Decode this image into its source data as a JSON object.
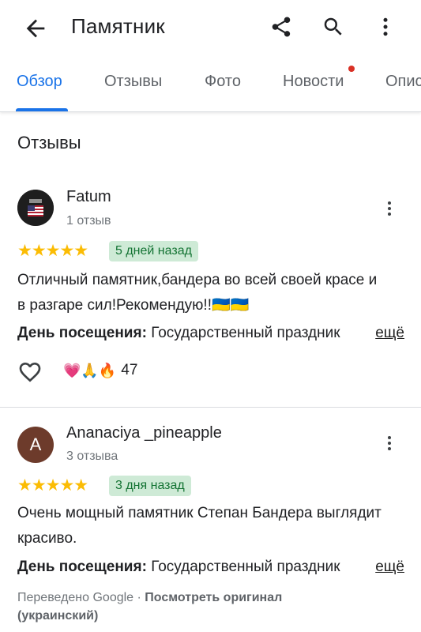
{
  "header": {
    "title": "Памятник"
  },
  "tabs": [
    {
      "label": "Обзор",
      "active": true
    },
    {
      "label": "Отзывы",
      "active": false
    },
    {
      "label": "Фото",
      "active": false
    },
    {
      "label": "Новости",
      "active": false,
      "has_dot": true
    },
    {
      "label": "Описание",
      "active": false
    }
  ],
  "section_title": "Отзывы",
  "reviews": [
    {
      "name": "Fatum",
      "review_count": "1 отзыв",
      "stars": "★★★★★",
      "time": "5 дней назад",
      "text": "Отличный памятник,бандера во всей своей красе и в  разгаре сил!Рекомендую!!🇺🇦🇺🇦",
      "visit_label": "День посещения:",
      "visit_value": "Государственный праздник",
      "more_link": "ещё",
      "reactions": "💗🙏🔥",
      "like_count": "47"
    },
    {
      "name": "Ananaciya _pineapple",
      "avatar_letter": "A",
      "review_count": "3 отзыва",
      "stars": "★★★★★",
      "time": "3 дня назад",
      "text": "Очень мощный памятник Степан Бандера выглядит красиво.",
      "visit_label": "День посещения:",
      "visit_value": "Государственный праздник",
      "more_link": "ещё",
      "translated_prefix": "Переведено Google · ",
      "translated_link": "Посмотреть оригинал",
      "translated_lang": "(украинский)"
    }
  ],
  "colors": {
    "accent": "#1a73e8",
    "star": "#fbbc04",
    "badge_bg": "#ceead6",
    "badge_text": "#137333",
    "dot": "#d93025"
  }
}
